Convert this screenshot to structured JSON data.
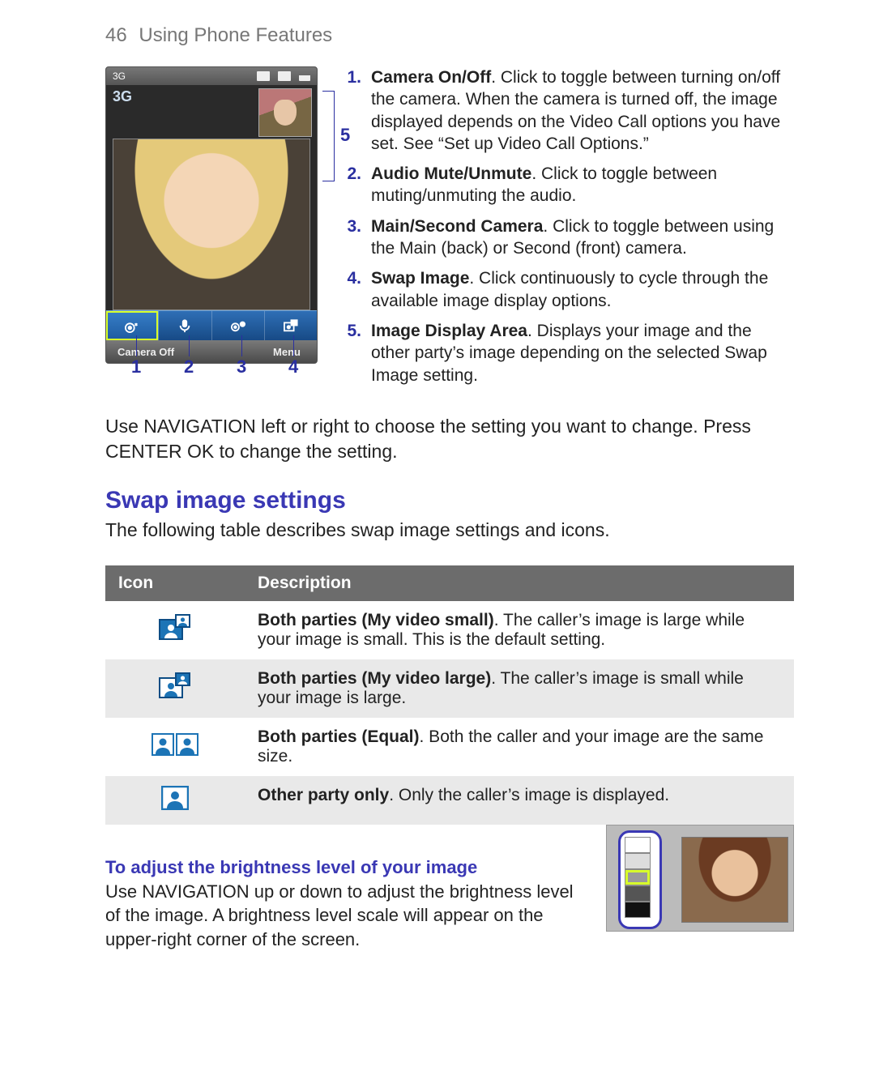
{
  "header": {
    "page_number": "46",
    "title": "Using Phone Features"
  },
  "phone": {
    "status_3g": "3G",
    "label_3g": "3G",
    "toolbar": {
      "camera_off": {
        "name": "camera-off-toggle"
      },
      "mic": {
        "name": "audio-mute-toggle"
      },
      "cam_swap": {
        "name": "main-second-camera-toggle"
      },
      "swap_image": {
        "name": "swap-image-button"
      }
    },
    "softkey_left": "Camera Off",
    "softkey_right": "Menu"
  },
  "callouts": {
    "c1": "1",
    "c2": "2",
    "c3": "3",
    "c4": "4",
    "c5": "5"
  },
  "list": [
    {
      "n": "1.",
      "bold": "Camera On/Off",
      "rest": ". Click to toggle between turning on/off the camera. When the camera is turned off, the image displayed depends on the Video Call options you have set. See “Set up Video Call Options.”"
    },
    {
      "n": "2.",
      "bold": "Audio Mute/Unmute",
      "rest": ". Click to toggle between muting/unmuting the audio."
    },
    {
      "n": "3.",
      "bold": "Main/Second Camera",
      "rest": ". Click to toggle between using the Main (back) or Second (front) camera."
    },
    {
      "n": "4.",
      "bold": "Swap Image",
      "rest": ". Click continuously to cycle through the available image display options."
    },
    {
      "n": "5.",
      "bold": "Image Display Area",
      "rest": ". Displays your image and the other party’s image depending on the selected Swap Image setting."
    }
  ],
  "nav_text": "Use NAVIGATION left or right to choose the setting you want to change. Press CENTER OK to change the setting.",
  "section_heading": "Swap image settings",
  "section_intro": "The following table describes swap image settings and icons.",
  "table": {
    "headers": {
      "icon": "Icon",
      "desc": "Description"
    },
    "rows": [
      {
        "icon": "both-small-icon",
        "bold": "Both parties (My video small)",
        "rest": ". The caller’s image is large while your image is small. This is the default setting."
      },
      {
        "icon": "both-large-icon",
        "bold": "Both parties (My video large)",
        "rest": ". The caller’s image is small while your image is large."
      },
      {
        "icon": "both-equal-icon",
        "bold": "Both parties (Equal)",
        "rest": ". Both the caller and your image are the same size."
      },
      {
        "icon": "other-only-icon",
        "bold": "Other party only",
        "rest": ". Only the caller’s image is displayed."
      }
    ]
  },
  "brightness": {
    "heading": "To adjust the brightness level of your image",
    "text": "Use NAVIGATION up or down to adjust the brightness level of the image. A brightness level scale will appear on the upper-right corner of the screen."
  }
}
